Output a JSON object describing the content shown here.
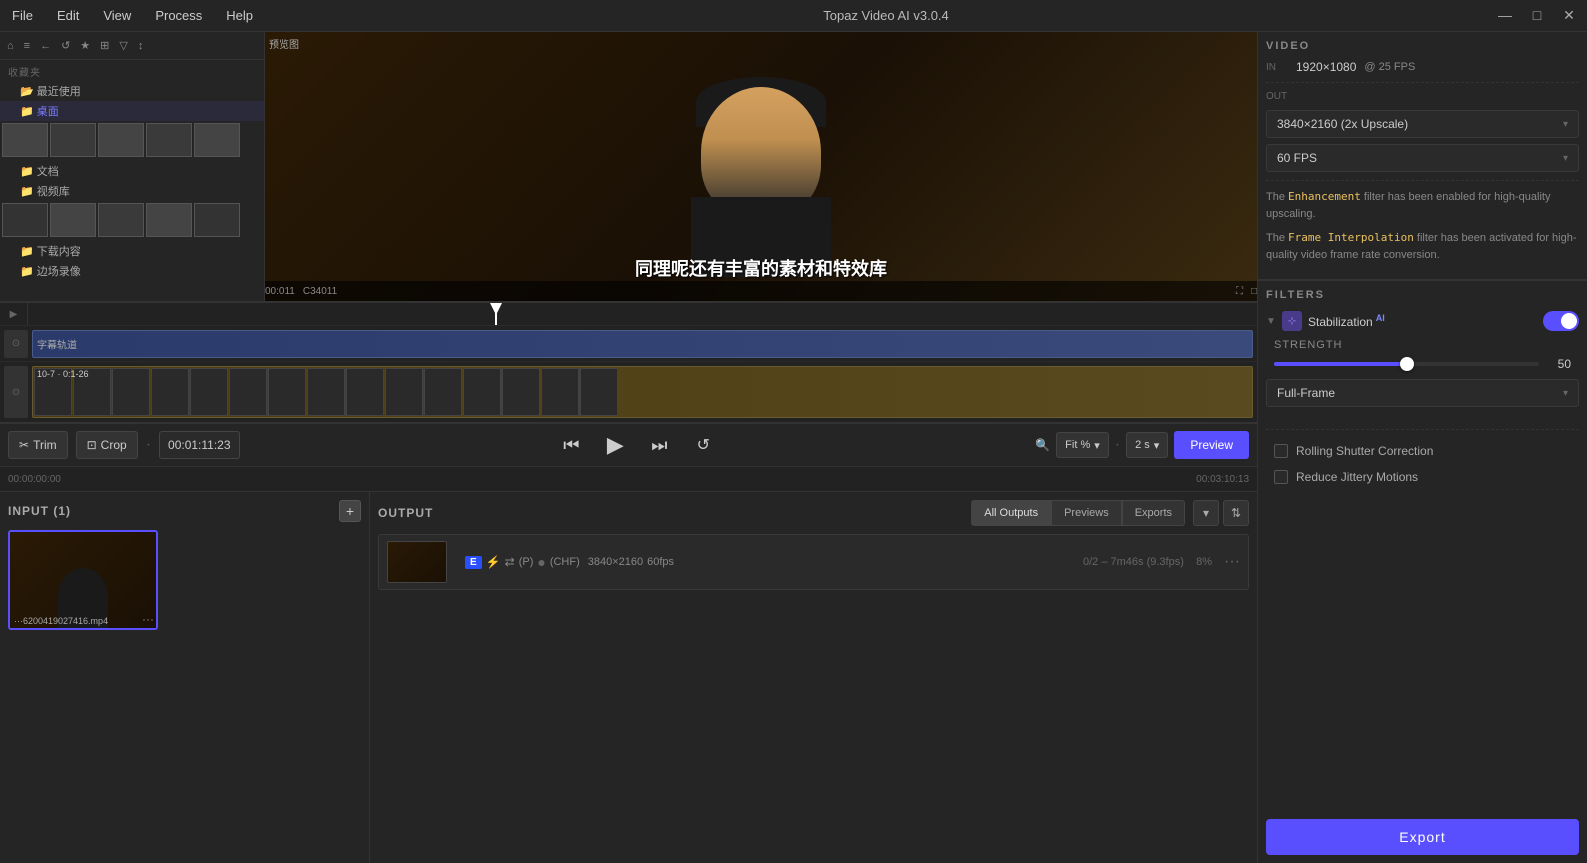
{
  "titlebar": {
    "menu": [
      "File",
      "Edit",
      "View",
      "Process",
      "Help"
    ],
    "title": "Topaz Video AI   v3.0.4",
    "controls": [
      "—",
      "□",
      "✕"
    ]
  },
  "toolbar": {
    "trim_label": "Trim",
    "crop_label": "Crop",
    "timecode": "00:01:11:23",
    "time_start": "00:00:00:00",
    "time_end": "00:03:10:13",
    "zoom_label": "Fit %",
    "interval_label": "2 s",
    "preview_label": "Preview"
  },
  "preview": {
    "top_label": "预览图",
    "subtitle_text": "同理呢还有丰富的素材和特效库",
    "timecode_left": "00:011",
    "timecode_right": "C34011",
    "counter": "□"
  },
  "input_panel": {
    "title": "INPUT (1)",
    "add_btn": "+",
    "file_label": "···6200419027416.mp4",
    "more_icon": "···"
  },
  "output_panel": {
    "title": "OUTPUT",
    "tabs": [
      "All Outputs",
      "Previews",
      "Exports"
    ],
    "active_tab": "All Outputs",
    "item": {
      "badge": "E",
      "icons": [
        "⚡",
        "⇄"
      ],
      "tag_p": "(P)",
      "tag_circle": "●",
      "tag_chf": "(CHF)",
      "resolution": "3840×2160",
      "fps": "60fps",
      "progress": "0/2 –",
      "duration": "7m46s (9.3fps)",
      "percent": "8%",
      "menu": "···"
    }
  },
  "right_panel": {
    "video_section": "VIDEO",
    "in_label": "IN",
    "out_label": "OUT",
    "in_resolution": "1920×1080",
    "in_fps": "@ 25 FPS",
    "out_resolution": "3840×2160 (2x Upscale)",
    "out_fps": "60 FPS",
    "description_1_prefix": "The ",
    "description_1_keyword": "Enhancement",
    "description_1_suffix": " filter has been enabled for high-quality upscaling.",
    "description_2_prefix": "The ",
    "description_2_keyword": "Frame Interpolation",
    "description_2_suffix": " filter has been activated for high-quality video frame rate conversion.",
    "filters_title": "FILTERS",
    "stabilization": {
      "label": "Stabilization",
      "ai_badge": "AI",
      "enabled": true
    },
    "strength_label": "STRENGTH",
    "strength_value": "50",
    "strength_percent": 50,
    "frame_mode": "Full-Frame",
    "rolling_shutter": "Rolling Shutter Correction",
    "reduce_jittery": "Reduce Jittery Motions",
    "export_label": "Export"
  },
  "file_browser": {
    "tree_items": [
      {
        "label": "收藏夹",
        "level": 0
      },
      {
        "label": "最近使用",
        "level": 1,
        "active": false
      },
      {
        "label": "桌面",
        "level": 1,
        "active": true
      },
      {
        "label": "文档",
        "level": 1,
        "active": false
      },
      {
        "label": "视频库",
        "level": 1,
        "active": false
      },
      {
        "label": "下载内容",
        "level": 1,
        "active": false
      },
      {
        "label": "边场录像",
        "level": 1,
        "active": false
      }
    ]
  }
}
